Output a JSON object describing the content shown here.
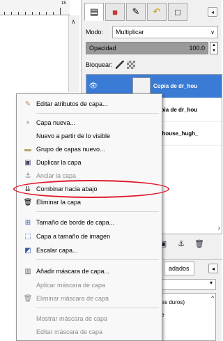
{
  "ruler": {
    "label": "15"
  },
  "dock": {
    "tabs": [
      "layers-icon",
      "channels-icon",
      "paths-icon",
      "undo-icon",
      "fill-icon"
    ],
    "mode": {
      "label": "Modo:",
      "value": "Multiplicar"
    },
    "opacity": {
      "label": "Opacidad",
      "value": "100.0"
    },
    "lock": {
      "label": "Bloquear:"
    },
    "layers": [
      {
        "name": "Copia de dr_hou",
        "selected": true
      },
      {
        "name": "Copia de dr_hou",
        "selected": false
      },
      {
        "name": "dr_house_hugh_",
        "selected": false
      }
    ]
  },
  "lower": {
    "tab": "adados",
    "items": [
      "(bordes duros)",
      "arente"
    ]
  },
  "menu": {
    "items": [
      {
        "label": "Editar atributos de capa...",
        "icon": "edit-icon",
        "enabled": true
      },
      {
        "label": "Capa nueva...",
        "icon": "new-layer-icon",
        "enabled": true
      },
      {
        "label": "Nuevo a partir de lo visible",
        "icon": "",
        "enabled": true
      },
      {
        "label": "Grupo de capas nuevo...",
        "icon": "folder-icon",
        "enabled": true
      },
      {
        "label": "Duplicar la capa",
        "icon": "duplicate-icon",
        "enabled": true
      },
      {
        "label": "Anclar la capa",
        "icon": "anchor-icon",
        "enabled": false
      },
      {
        "label": "Combinar hacia abajo",
        "icon": "merge-down-icon",
        "enabled": true
      },
      {
        "label": "Eliminar la capa",
        "icon": "trash-icon",
        "enabled": true
      },
      {
        "label": "Tamaño de borde de capa...",
        "icon": "layer-boundary-icon",
        "enabled": true
      },
      {
        "label": "Capa a tamaño de imagen",
        "icon": "layer-to-image-icon",
        "enabled": true
      },
      {
        "label": "Escalar capa...",
        "icon": "scale-icon",
        "enabled": true
      },
      {
        "label": "Añadir máscara de capa...",
        "icon": "mask-icon",
        "enabled": true
      },
      {
        "label": "Aplicar máscara de capa",
        "icon": "",
        "enabled": false
      },
      {
        "label": "Eliminar máscara de capa",
        "icon": "trash-icon",
        "enabled": false
      },
      {
        "label": "Mostrar máscara de capa",
        "icon": "",
        "enabled": false
      },
      {
        "label": "Editar máscara de capa",
        "icon": "",
        "enabled": false
      }
    ]
  },
  "highlight_color": "#e0192b",
  "selection_color": "#3a7bd5"
}
